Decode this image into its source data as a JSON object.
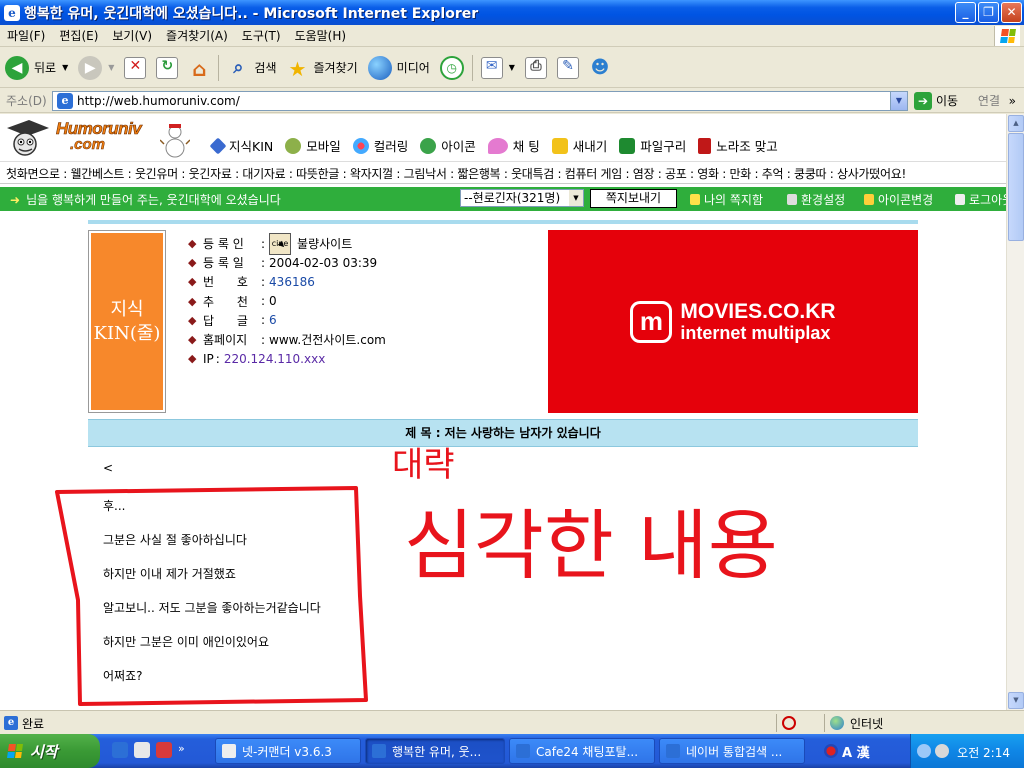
{
  "window": {
    "title": "행복한 유머, 웃긴대학에 오셨습니다.. - Microsoft Internet Explorer",
    "icon": "ie-icon"
  },
  "menu": [
    "파일(F)",
    "편집(E)",
    "보기(V)",
    "즐겨찾기(A)",
    "도구(T)",
    "도움말(H)"
  ],
  "toolbar": {
    "back": "뒤로",
    "search": "검색",
    "favorites": "즐겨찾기",
    "media": "미디어"
  },
  "address": {
    "label": "주소(D)",
    "url": "http://web.humoruniv.com/",
    "go": "이동",
    "links": "연결"
  },
  "site": {
    "logo_text": "Humoruniv",
    "logo_domain": ".com",
    "nav": [
      "지식KIN",
      "모바일",
      "컬러링",
      "아이콘",
      "채 팅",
      "새내기",
      "파일구리",
      "노라조 맞고"
    ],
    "categories": "첫화면으로 : 웰간베스트 : 웃긴유머 : 웃긴자료 : 대기자료 : 따뜻한글 : 왁자지껄 : 그림낙서 : 짧은행복 : 웃대특검 : 컴퓨터 게임 : 염장 : 공포 : 영화 : 만화 : 추억 : 쿵쿵따 : 상사가떴어요!",
    "welcome": "님을 행복하게 만들어 주는, 웃긴대학에 오셨습니다",
    "members_select": "--현로긴자(321명)",
    "send_note": "쪽지보내기",
    "links": [
      "나의 쪽지함",
      "환경설정",
      "아이콘변경",
      "로그아웃"
    ]
  },
  "post": {
    "kin_line1": "지식",
    "kin_line2": "KIN(줄)",
    "info": {
      "registrant_label": "등 록 인",
      "registrant_icon_text": "cine",
      "registrant": "불량사이트",
      "date_label": "등 록 일",
      "date": "2004-02-03 03:39",
      "number_label": "번      호",
      "number": "436186",
      "recommend_label": "추      천",
      "recommend": "0",
      "replies_label": "답      글",
      "replies": "6",
      "homepage_label": "홈페이지",
      "homepage": "www.건전사이트.com",
      "ip_label": "IP",
      "ip": "220.124.110.xxx"
    },
    "ad": {
      "line1": "MOVIES.CO.KR",
      "line2": "internet multiplax"
    },
    "subject": "제 목 : 저는 사랑하는 남자가 있습니다",
    "body_lines": [
      "<",
      "후...",
      "그분은 사실 절 좋아하십니다",
      "하지만 이내 제가 거절했죠",
      "알고보니.. 저도 그분을 좋아하는거같습니다",
      "하지만 그분은 이미 애인이있어요",
      "어쩌죠?"
    ],
    "annotation_small": "대략",
    "annotation_large": "심각한 내용",
    "annotation_color": "#e8141c"
  },
  "status": {
    "text": "완료",
    "zone": "인터넷"
  },
  "taskbar": {
    "start": "시작",
    "tasks": [
      "넷-커맨더 v3.6.3",
      "행복한 유머, 웃...",
      "Cafe24 채팅포탈...",
      "네이버 통합검색 ..."
    ],
    "ime": "A 漢",
    "clock": "오전 2:14"
  }
}
